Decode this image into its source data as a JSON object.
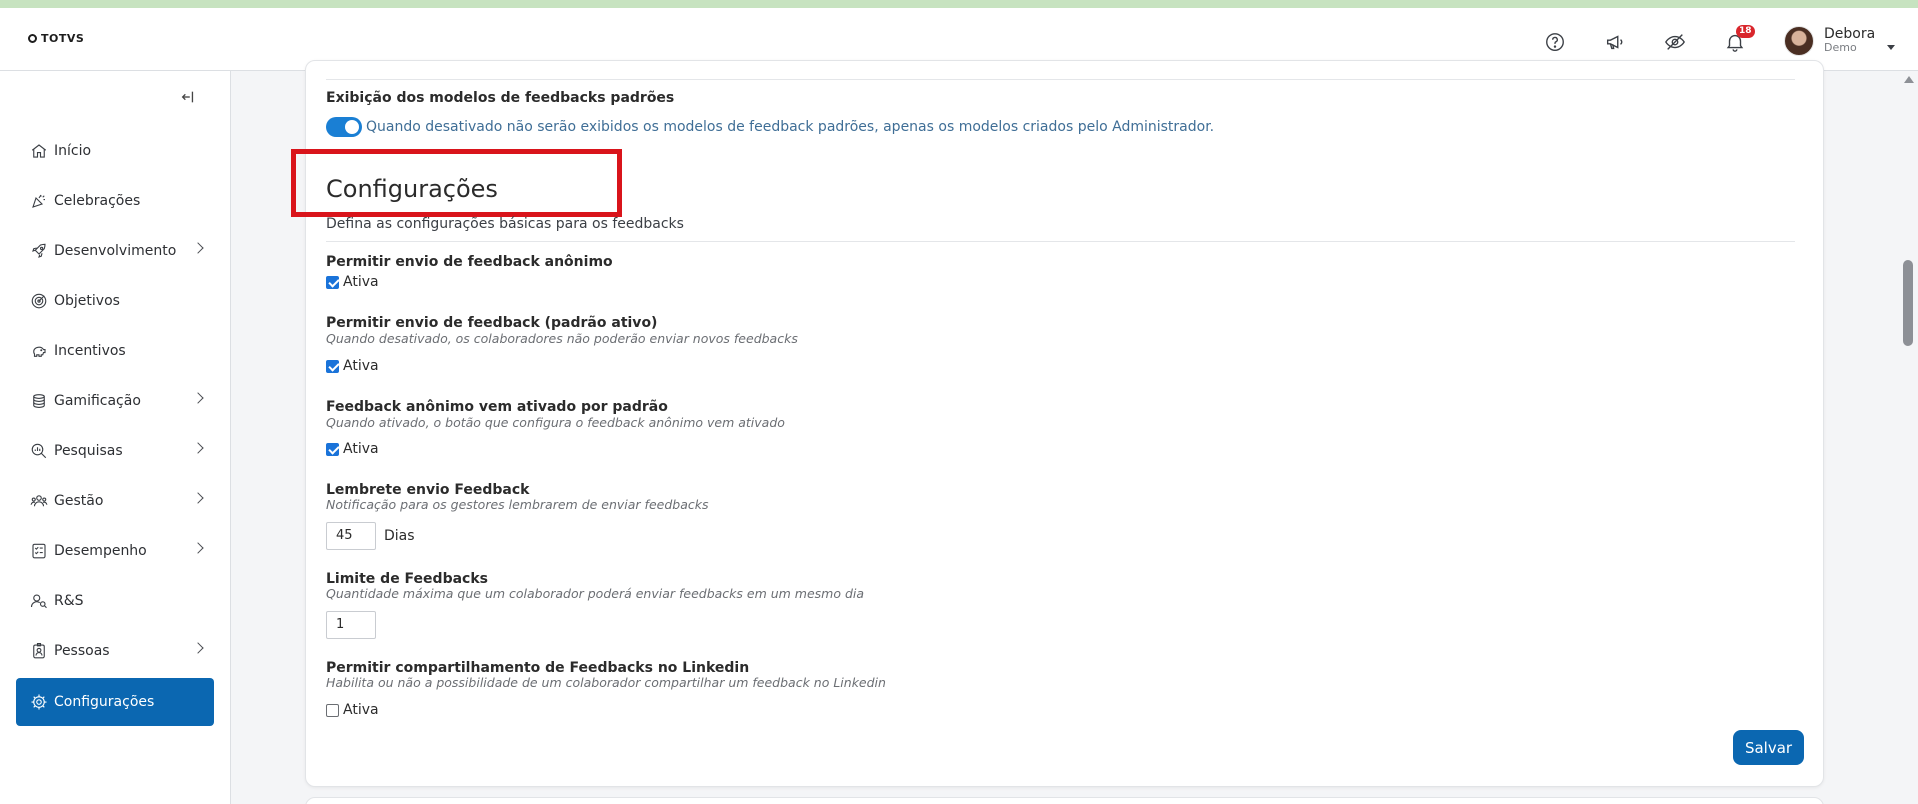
{
  "header": {
    "logo_text": "TOTVS",
    "notifications_count": "18",
    "user_name": "Debora",
    "user_role": "Demo"
  },
  "sidebar": {
    "items": [
      {
        "label": "Início",
        "icon": "home-icon",
        "has_submenu": false
      },
      {
        "label": "Celebrações",
        "icon": "party-icon",
        "has_submenu": false
      },
      {
        "label": "Desenvolvimento",
        "icon": "rocket-icon",
        "has_submenu": true
      },
      {
        "label": "Objetivos",
        "icon": "target-icon",
        "has_submenu": false
      },
      {
        "label": "Incentivos",
        "icon": "piggy-bank-icon",
        "has_submenu": false
      },
      {
        "label": "Gamificação",
        "icon": "coins-icon",
        "has_submenu": true
      },
      {
        "label": "Pesquisas",
        "icon": "search-chart-icon",
        "has_submenu": true
      },
      {
        "label": "Gestão",
        "icon": "team-icon",
        "has_submenu": true
      },
      {
        "label": "Desempenho",
        "icon": "checklist-icon",
        "has_submenu": true
      },
      {
        "label": "R&S",
        "icon": "user-search-icon",
        "has_submenu": false
      },
      {
        "label": "Pessoas",
        "icon": "badge-icon",
        "has_submenu": true
      },
      {
        "label": "Configurações",
        "icon": "gear-icon",
        "has_submenu": false,
        "active": true
      }
    ]
  },
  "content": {
    "default_models": {
      "title": "Exibição dos modelos de feedbacks padrões",
      "toggle_on": true,
      "toggle_text": "Quando desativado não serão exibidos os modelos de feedback padrões, apenas os modelos criados pelo Administrador."
    },
    "section_title": "Configurações",
    "section_subtitle": "Defina as configurações básicas para os feedbacks",
    "anonymous": {
      "title": "Permitir envio de feedback anônimo",
      "checkbox_label": "Ativa",
      "checked": true
    },
    "allow_send": {
      "title": "Permitir envio de feedback (padrão ativo)",
      "desc": "Quando desativado, os colaboradores não poderão enviar novos feedbacks",
      "checkbox_label": "Ativa",
      "checked": true
    },
    "anonymous_default": {
      "title": "Feedback anônimo vem ativado por padrão",
      "desc": "Quando ativado, o botão que configura o feedback anônimo vem ativado",
      "checkbox_label": "Ativa",
      "checked": true
    },
    "reminder": {
      "title": "Lembrete envio Feedback",
      "desc": "Notificação para os gestores lembrarem de enviar feedbacks",
      "value": "45",
      "unit": "Dias"
    },
    "limit": {
      "title": "Limite de Feedbacks",
      "desc": "Quantidade máxima que um colaborador poderá enviar feedbacks em um mesmo dia",
      "value": "1"
    },
    "linkedin": {
      "title": "Permitir compartilhamento de Feedbacks no Linkedin",
      "desc": "Habilita ou não a possibilidade de um colaborador compartilhar um feedback no Linkedin",
      "checkbox_label": "Ativa",
      "checked": false
    },
    "save_label": "Salvar"
  },
  "colors": {
    "primary": "#0b67b1",
    "toggle": "#1a7fd4",
    "highlight_box": "#d9141b",
    "badge": "#d9262c"
  }
}
